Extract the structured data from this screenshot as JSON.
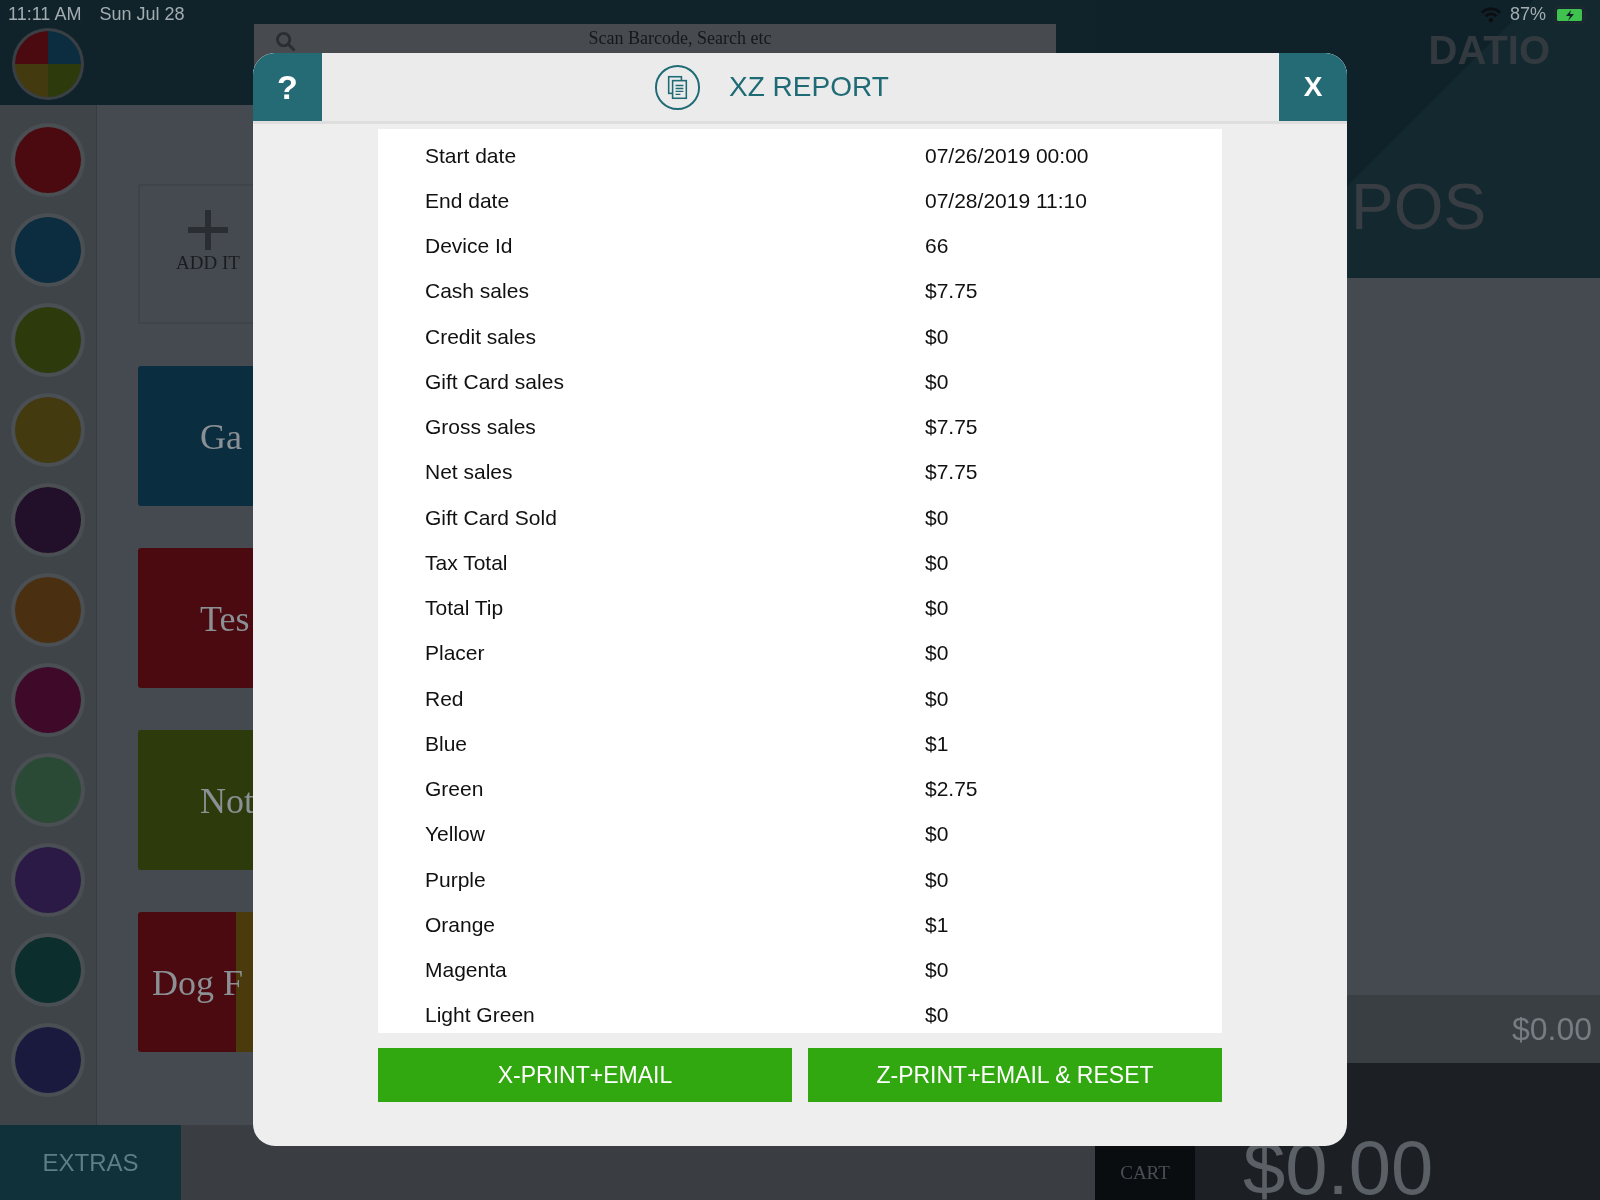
{
  "status_bar": {
    "time": "11:11 AM",
    "date": "Sun Jul 28",
    "battery": "87%"
  },
  "search": {
    "placeholder": "Scan Barcode, Search etc"
  },
  "categories": [
    {
      "color": "#4a0a10"
    },
    {
      "color": "#0c2d40"
    },
    {
      "color": "#2d3a0c"
    },
    {
      "color": "#433a10"
    },
    {
      "color": "#22102a"
    },
    {
      "color": "#4a3010"
    },
    {
      "color": "#3f0a2a"
    },
    {
      "color": "#2a4a35"
    },
    {
      "color": "#2a1a45"
    },
    {
      "color": "#0c2f2e"
    },
    {
      "color": "#1a1a3f"
    }
  ],
  "tiles": [
    {
      "kind": "add",
      "label": "ADD IT"
    },
    {
      "kind": "item",
      "label": "Ga",
      "color": "#0b2d40"
    },
    {
      "kind": "item",
      "label": "Tes",
      "color": "#4a0a10"
    },
    {
      "kind": "item",
      "label": "Not",
      "color": "#2d3a0c"
    },
    {
      "kind": "item",
      "label": "Dog F",
      "color": "#4a0a10",
      "stripe": {
        "color": "#4a3a0c"
      }
    }
  ],
  "extras_button": "EXTRAS",
  "brand": {
    "name": "DATIO",
    "product": "POS"
  },
  "cart": {
    "subtotal": "$0.00",
    "total": "$0.00",
    "button": "CART"
  },
  "dialog": {
    "title": "XZ REPORT",
    "help_button": "?",
    "close_button": "X",
    "rows": [
      {
        "label": "Start date",
        "value": "07/26/2019 00:00"
      },
      {
        "label": "End date",
        "value": "07/28/2019 11:10"
      },
      {
        "label": "Device Id",
        "value": "66"
      },
      {
        "label": "Cash sales",
        "value": "$7.75"
      },
      {
        "label": "Credit sales",
        "value": "$0"
      },
      {
        "label": "Gift Card sales",
        "value": "$0"
      },
      {
        "label": "Gross sales",
        "value": "$7.75"
      },
      {
        "label": "Net sales",
        "value": "$7.75"
      },
      {
        "label": "Gift Card Sold",
        "value": "$0"
      },
      {
        "label": "Tax Total",
        "value": "$0"
      },
      {
        "label": "Total Tip",
        "value": "$0"
      },
      {
        "label": "Placer",
        "value": "$0"
      },
      {
        "label": "Red",
        "value": "$0"
      },
      {
        "label": "Blue",
        "value": "$1"
      },
      {
        "label": "Green",
        "value": "$2.75"
      },
      {
        "label": "Yellow",
        "value": "$0"
      },
      {
        "label": "Purple",
        "value": "$0"
      },
      {
        "label": "Orange",
        "value": "$1"
      },
      {
        "label": "Magenta",
        "value": "$0"
      },
      {
        "label": "Light Green",
        "value": "$0"
      }
    ],
    "buttons": [
      "X-PRINT+EMAIL",
      "Z-PRINT+EMAIL & RESET"
    ]
  }
}
